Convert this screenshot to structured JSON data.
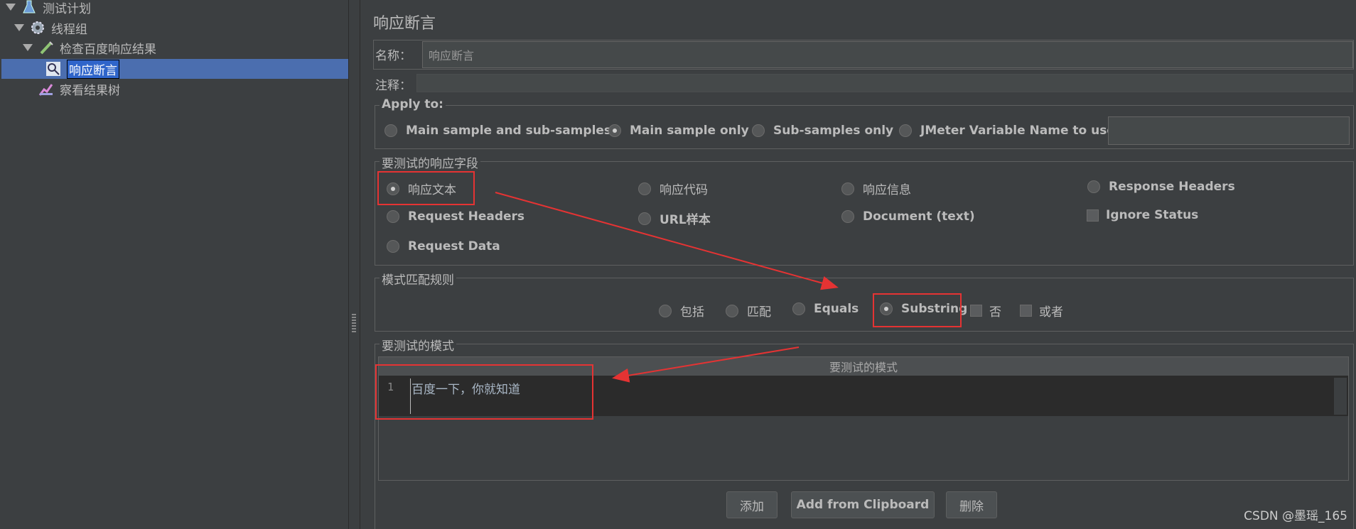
{
  "tree": {
    "items": [
      {
        "label": "测试计划"
      },
      {
        "label": "线程组"
      },
      {
        "label": "检查百度响应结果"
      },
      {
        "label": "响应断言"
      },
      {
        "label": "察看结果树"
      }
    ]
  },
  "panel": {
    "title": "响应断言",
    "name_label": "名称：",
    "name_value": "响应断言",
    "comment_label": "注释：",
    "comment_value": "",
    "apply_to": {
      "legend": "Apply to:",
      "options": [
        "Main sample and sub-samples",
        "Main sample only",
        "Sub-samples only",
        "JMeter Variable Name to use"
      ],
      "selected": "Main sample only",
      "variable_value": ""
    },
    "field_to_test": {
      "legend": "要测试的响应字段",
      "options": [
        "响应文本",
        "响应代码",
        "响应信息",
        "Response Headers",
        "Request Headers",
        "URL样本",
        "Document (text)",
        "Request Data"
      ],
      "selected": "响应文本",
      "ignore_status_label": "Ignore Status",
      "ignore_status_checked": false
    },
    "pattern_rules": {
      "legend": "模式匹配规则",
      "options": [
        "包括",
        "匹配",
        "Equals",
        "Substring"
      ],
      "selected": "Substring",
      "not_label": "否",
      "or_label": "或者"
    },
    "patterns": {
      "legend": "要测试的模式",
      "column_header": "要测试的模式",
      "rows": [
        {
          "line": "1",
          "text": "百度一下，你就知道"
        }
      ]
    },
    "buttons": {
      "add": "添加",
      "add_clipboard": "Add from Clipboard",
      "delete": "删除"
    }
  },
  "watermark": "CSDN @墨瑶_165",
  "colors": {
    "background": "#3c3f41",
    "selection": "#4b6eaf",
    "highlight_box": "#e53333"
  }
}
